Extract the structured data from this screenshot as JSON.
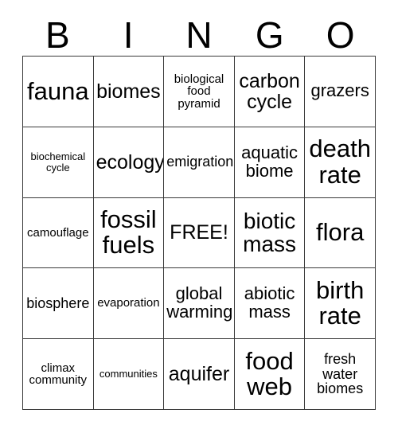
{
  "card": {
    "title": "BINGO",
    "header_letters": [
      "B",
      "I",
      "N",
      "G",
      "O"
    ],
    "free_space_label": "FREE!",
    "colors": {
      "text": "#000000",
      "grid_line": "#3a3a3a",
      "background": "#ffffff"
    },
    "grid": {
      "rows": 5,
      "columns": 5,
      "cells": [
        [
          {
            "label": "fauna",
            "size": "fs-xxl"
          },
          {
            "label": "biomes",
            "size": "fs-lg"
          },
          {
            "label": "biological food pyramid",
            "size": "fs-xs"
          },
          {
            "label": "carbon cycle",
            "size": "fs-lg"
          },
          {
            "label": "grazers",
            "size": "fs-md"
          }
        ],
        [
          {
            "label": "biochemical cycle",
            "size": "fs-xxs"
          },
          {
            "label": "ecology",
            "size": "fs-lg"
          },
          {
            "label": "emigration",
            "size": "fs-sm"
          },
          {
            "label": "aquatic biome",
            "size": "fs-md"
          },
          {
            "label": "death rate",
            "size": "fs-xxl"
          }
        ],
        [
          {
            "label": "camouflage",
            "size": "fs-xs"
          },
          {
            "label": "fossil fuels",
            "size": "fs-xxl"
          },
          {
            "label": "FREE!",
            "size": "fs-lg"
          },
          {
            "label": "biotic mass",
            "size": "fs-xl"
          },
          {
            "label": "flora",
            "size": "fs-xxl"
          }
        ],
        [
          {
            "label": "biosphere",
            "size": "fs-sm"
          },
          {
            "label": "evaporation",
            "size": "fs-xs"
          },
          {
            "label": "global warming",
            "size": "fs-md"
          },
          {
            "label": "abiotic mass",
            "size": "fs-md"
          },
          {
            "label": "birth rate",
            "size": "fs-xxl"
          }
        ],
        [
          {
            "label": "climax community",
            "size": "fs-xs"
          },
          {
            "label": "communities",
            "size": "fs-xxs"
          },
          {
            "label": "aquifer",
            "size": "fs-lg"
          },
          {
            "label": "food web",
            "size": "fs-xxl"
          },
          {
            "label": "fresh water biomes",
            "size": "fs-sm"
          }
        ]
      ]
    }
  }
}
